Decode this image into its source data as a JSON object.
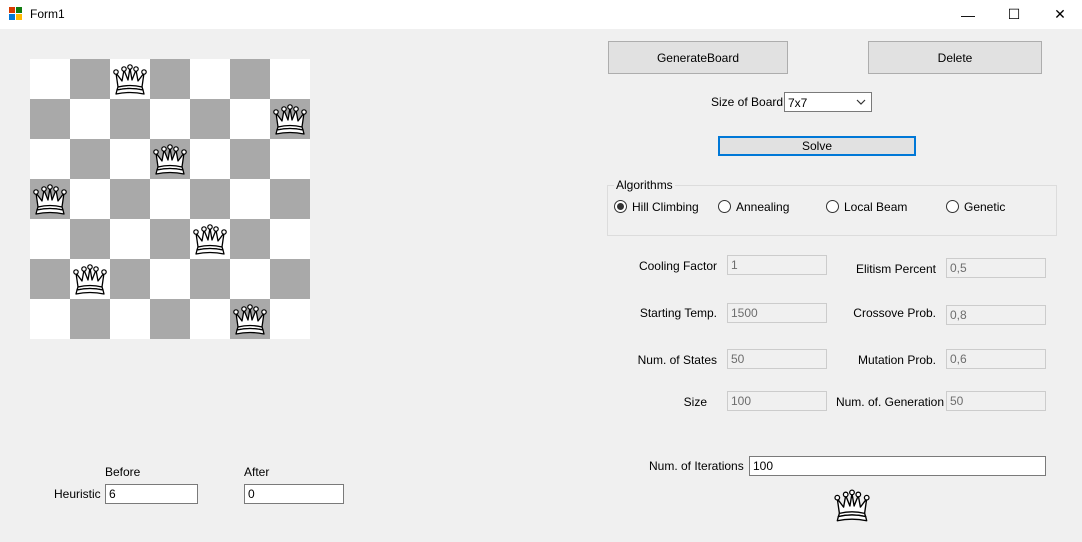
{
  "window": {
    "title": "Form1",
    "minimize_glyph": "—",
    "maximize_glyph": "☐",
    "close_glyph": "✕"
  },
  "board": {
    "size": 7,
    "queen_columns": [
      3,
      7,
      4,
      1,
      5,
      2,
      6
    ]
  },
  "buttons": {
    "generate": "GenerateBoard",
    "delete": "Delete",
    "solve": "Solve"
  },
  "size_of_board": {
    "label": "Size of Board",
    "value": "7x7"
  },
  "algorithms": {
    "title": "Algorithms",
    "options": [
      {
        "label": "Hill Climbing",
        "checked": true
      },
      {
        "label": "Annealing",
        "checked": false
      },
      {
        "label": "Local Beam",
        "checked": false
      },
      {
        "label": "Genetic",
        "checked": false
      }
    ]
  },
  "params": {
    "cooling_factor": {
      "label": "Cooling Factor",
      "value": "1"
    },
    "starting_temp": {
      "label": "Starting Temp.",
      "value": "1500"
    },
    "num_states": {
      "label": "Num. of States",
      "value": "50"
    },
    "size": {
      "label": "Size",
      "value": "100"
    },
    "elitism_percent": {
      "label": "Elitism Percent",
      "value": "0,5"
    },
    "crossover_prob": {
      "label": "Crossove Prob.",
      "value": "0,8"
    },
    "mutation_prob": {
      "label": "Mutation Prob.",
      "value": "0,6"
    },
    "num_generation": {
      "label": "Num. of. Generation",
      "value": "50"
    }
  },
  "iterations": {
    "label": "Num. of Iterations",
    "value": "100"
  },
  "heuristic": {
    "label": "Heuristic",
    "before_label": "Before",
    "after_label": "After",
    "before_value": "6",
    "after_value": "0"
  }
}
